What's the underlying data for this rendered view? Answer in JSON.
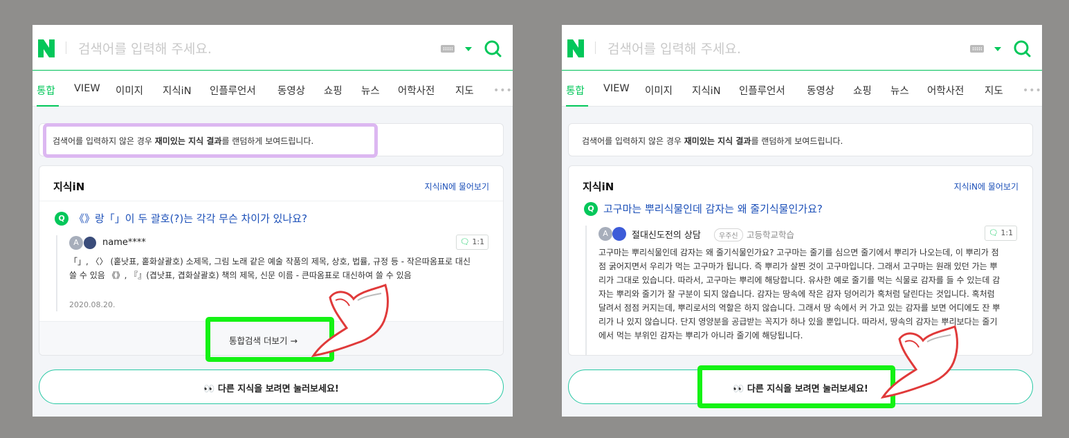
{
  "search": {
    "placeholder": "검색어를 입력해 주세요.",
    "logo": "N"
  },
  "tabs": [
    "통합",
    "VIEW",
    "이미지",
    "지식iN",
    "인플루언서",
    "동영상",
    "쇼핑",
    "뉴스",
    "어학사전",
    "지도"
  ],
  "more_tabs": "•••",
  "notice": {
    "before": "검색어를 입력하지 않은 경우 ",
    "bold": "재미있는 지식 결과",
    "after": "를 랜덤하게 보여드립니다."
  },
  "card": {
    "title": "지식iN",
    "link": "지식iN에 물어보기",
    "q_mark": "Q",
    "chat_label": "1:1"
  },
  "left": {
    "question": "《》랑「」이 두 괄호(?)는 각각 무슨 차이가 있나요?",
    "avatar_letter": "A",
    "username": "name****",
    "answer": "「」, 〈〉 (홑낫표, 홑화살괄호) 소제목, 그림 노래 같은 예술 작품의 제목, 상호, 법률, 규정 등 - 작은따옴표로 대신 쓸 수 있음 《》, 『』(겹낫표, 겹화살괄호) 책의 제목, 신문 이름 - 큰따옴표로 대신하여 쓸 수 있음",
    "date": "2020.08.20.",
    "more_button": "통합검색 더보기 →"
  },
  "right": {
    "question": "고구마는 뿌리식물인데 감자는 왜 줄기식물인가요?",
    "avatar_letter": "A",
    "username": "절대신도전의 상담",
    "badge": "우주신",
    "category": "고등학교학습",
    "answer": "고구마는 뿌리식물인데 감자는 왜 줄기식물인가요? 고구마는 줄기를 심으면 줄기에서 뿌리가 나오는데, 이 뿌리가 점점 굵어지면서 우리가 먹는 고구마가 됩니다. 즉 뿌리가 살찐 것이 고구마입니다. 그래서 고구마는 원래 있던 가는 뿌리가 그대로 있습니다. 따라서, 고구마는 뿌리에 해당합니다. 유사한 예로 줄기를 먹는 식물로 감자를 들 수 있는데 감자는 뿌리와 줄기가 잘 구분이 되지 않습니다. 감자는 땅속에 작은 감자 덩어리가 혹처럼 달린다는 것입니다. 혹처럼 달려서 점점 커지는데, 뿌리로서의 역할은 하지 않습니다. 그래서 땅 속에서 커 가고 있는 감자를 보면 어디에도 잔 뿌리가 나 있지 않습니다. 단지 영양분을 공급받는 꼭지가 하나 있을 뿐입니다. 따라서, 땅속의 감자는 뿌리보다는 줄기에서 먹는 부위인 감자는 뿌리가 아니라 줄기에 해당됩니다."
  },
  "big_button": "👀  다른 지식을 보려면 눌러보세요!",
  "colors": {
    "brand": "#03c75a",
    "link": "#1b4fb8",
    "highlight_green": "#14f214",
    "highlight_purple": "#dcb7f1"
  }
}
